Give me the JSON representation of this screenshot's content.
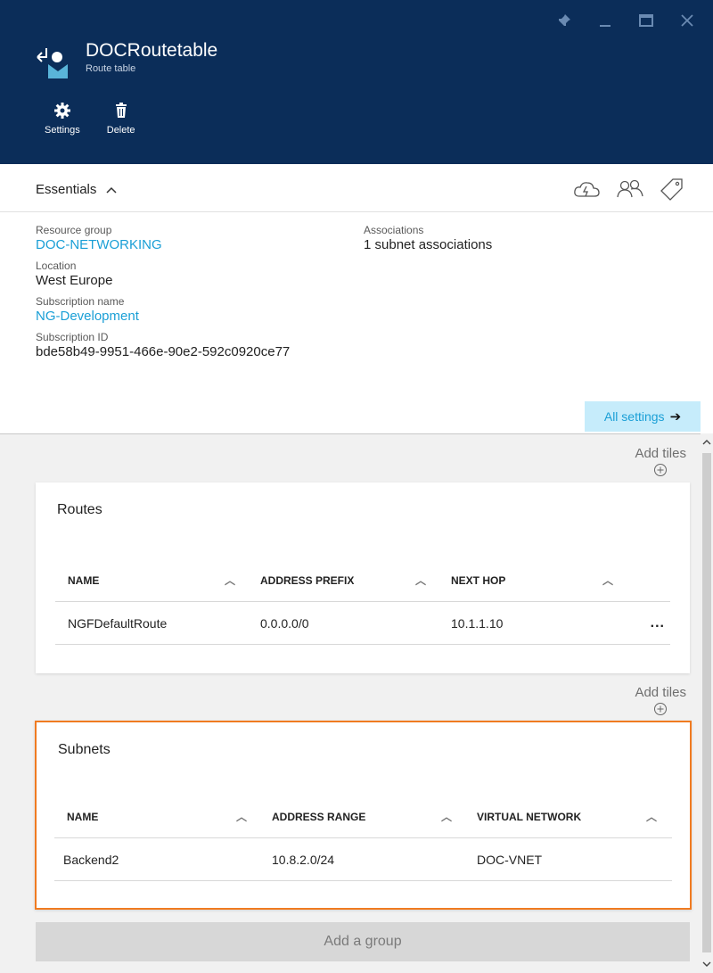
{
  "header": {
    "title": "DOCRoutetable",
    "subtitle": "Route table",
    "commands": [
      {
        "label": "Settings",
        "icon": "gear-icon"
      },
      {
        "label": "Delete",
        "icon": "trash-icon"
      }
    ],
    "background": "#0b2d59"
  },
  "essentials": {
    "title": "Essentials",
    "left": [
      {
        "label": "Resource group",
        "value": "DOC-NETWORKING",
        "link": true
      },
      {
        "label": "Location",
        "value": "West Europe",
        "link": false
      },
      {
        "label": "Subscription name",
        "value": "NG-Development",
        "link": true
      },
      {
        "label": "Subscription ID",
        "value": "bde58b49-9951-466e-90e2-592c0920ce77",
        "link": false
      }
    ],
    "right": [
      {
        "label": "Associations",
        "value": "1 subnet associations"
      }
    ],
    "all_settings": "All settings",
    "link_color": "#1a9fd6"
  },
  "lens": {
    "add_tiles": "Add tiles",
    "add_group": "Add a group"
  },
  "routes": {
    "title": "Routes",
    "columns": [
      "NAME",
      "ADDRESS PREFIX",
      "NEXT HOP"
    ],
    "rows": [
      {
        "name": "NGFDefaultRoute",
        "prefix": "0.0.0.0/0",
        "next_hop": "10.1.1.10",
        "more": "..."
      }
    ]
  },
  "subnets": {
    "title": "Subnets",
    "columns": [
      "NAME",
      "ADDRESS RANGE",
      "VIRTUAL NETWORK"
    ],
    "rows": [
      {
        "name": "Backend2",
        "range": "10.8.2.0/24",
        "vnet": "DOC-VNET"
      }
    ],
    "highlight": "#f07b21"
  }
}
